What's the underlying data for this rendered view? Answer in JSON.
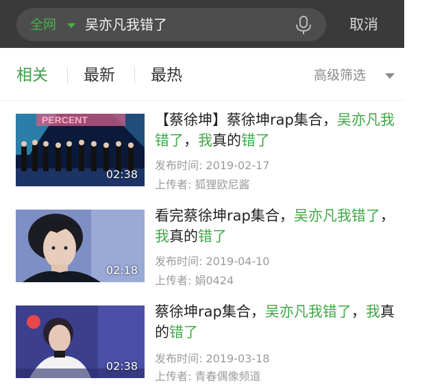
{
  "search": {
    "scope_label": "全网",
    "query": "吴亦凡我错了",
    "cancel_label": "取消"
  },
  "tabs": [
    {
      "label": "相关",
      "active": true
    },
    {
      "label": "最新",
      "active": false
    },
    {
      "label": "最热",
      "active": false
    }
  ],
  "filter_label": "高级筛选",
  "colors": {
    "accent": "#3ea845",
    "topbar": "#3a3a3a",
    "meta_gray": "#9b9b9b"
  },
  "results": [
    {
      "title_parts": [
        {
          "text": "【蔡徐坤】蔡徐坤rap集合，",
          "highlight": false
        },
        {
          "text": "吴亦凡我错了",
          "highlight": true
        },
        {
          "text": "，",
          "highlight": false
        },
        {
          "text": "我",
          "highlight": true
        },
        {
          "text": "真的",
          "highlight": false
        },
        {
          "text": "错了",
          "highlight": true
        }
      ],
      "date": "发布时间: 2019-02-17",
      "uploader": "上传者: 狐狸欧尼酱",
      "duration": "02:38",
      "thumb_text": "PERCENT"
    },
    {
      "title_parts": [
        {
          "text": "看完蔡徐坤rap集合，",
          "highlight": false
        },
        {
          "text": "吴亦凡我错了",
          "highlight": true
        },
        {
          "text": "，",
          "highlight": false
        },
        {
          "text": "我",
          "highlight": true
        },
        {
          "text": "真的",
          "highlight": false
        },
        {
          "text": "错了",
          "highlight": true
        }
      ],
      "date": "发布时间: 2019-04-10",
      "uploader": "上传者: 娟0424",
      "duration": "02:18"
    },
    {
      "title_parts": [
        {
          "text": "蔡徐坤rap集合，",
          "highlight": false
        },
        {
          "text": "吴亦凡我错了",
          "highlight": true
        },
        {
          "text": "，",
          "highlight": false
        },
        {
          "text": "我",
          "highlight": true
        },
        {
          "text": "真的",
          "highlight": false
        },
        {
          "text": "错了",
          "highlight": true
        }
      ],
      "date": "发布时间: 2019-03-18",
      "uploader": "上传者: 青春偶像频道",
      "duration": "02:38"
    }
  ]
}
